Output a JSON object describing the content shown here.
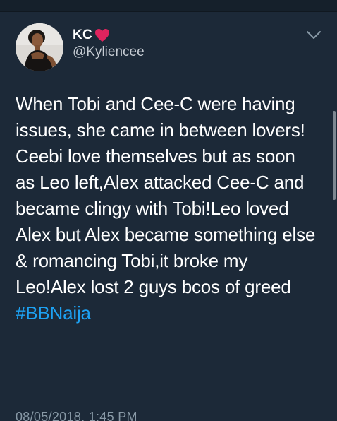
{
  "user": {
    "display_name": "KC",
    "handle": "@Kyliencee",
    "avatar_icon": "profile-photo-icon",
    "badge_icon": "red-heart-icon"
  },
  "tweet": {
    "text": "When Tobi and Cee-C were having issues, she came in between lovers! Ceebi love themselves but as soon as Leo left,Alex attacked Cee-C and became clingy with Tobi!Leo loved Alex but Alex became something else & romancing Tobi,it broke my Leo!Alex lost 2 guys bcos of greed",
    "hashtag": "#BBNaija",
    "timestamp": "08/05/2018, 1:45 PM"
  },
  "menu": {
    "icon": "chevron-down-icon"
  },
  "colors": {
    "background": "#1c2938",
    "hashtag": "#1da1f2",
    "muted_text": "#8899a6",
    "heart": "#e0245e"
  }
}
